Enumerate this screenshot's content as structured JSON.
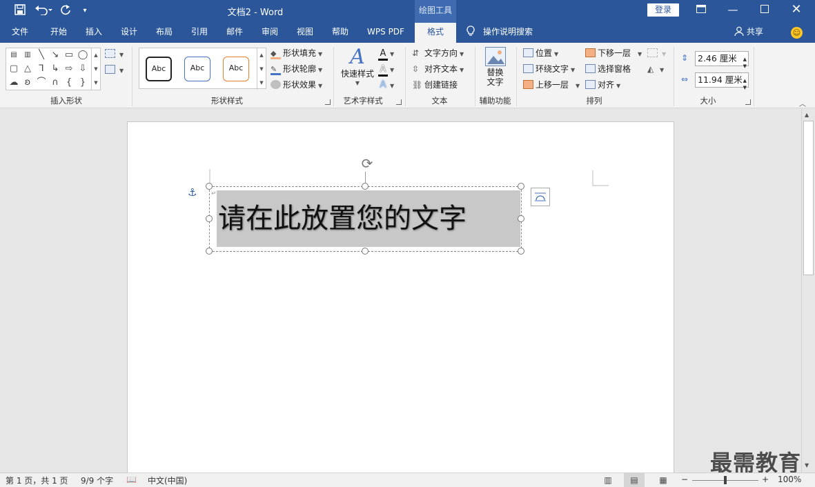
{
  "titlebar": {
    "doc_title": "文档2  -  Word",
    "context_tab_title": "绘图工具",
    "login_label": "登录",
    "icons": [
      "save-icon",
      "undo-icon",
      "redo-icon",
      "customize-quick-access-icon",
      "ribbon-display-options-icon",
      "minimize-icon",
      "maximize-icon",
      "close-icon"
    ]
  },
  "tabs": {
    "items": [
      "文件",
      "开始",
      "插入",
      "设计",
      "布局",
      "引用",
      "邮件",
      "审阅",
      "视图",
      "帮助",
      "WPS PDF",
      "格式"
    ],
    "active": "格式",
    "tell_me": "操作说明搜索",
    "share": "共享"
  },
  "ribbon": {
    "groups": {
      "insert_shapes": "插入形状",
      "shape_styles": "形状样式",
      "wordart_styles": "艺术字样式",
      "text": "文本",
      "accessibility": "辅助功能",
      "arrange": "排列",
      "size": "大小"
    },
    "shape_styles": {
      "previews": [
        "Abc",
        "Abc",
        "Abc"
      ],
      "preview_colors": [
        "#222222",
        "#4472c4",
        "#ed7d31"
      ],
      "fill": "形状填充",
      "outline": "形状轮廓",
      "effects": "形状效果"
    },
    "wordart": {
      "quick_styles": "快速样式"
    },
    "text": {
      "direction": "文字方向",
      "align": "对齐文本",
      "link": "创建链接"
    },
    "accessibility": {
      "alt_text_line1": "替换",
      "alt_text_line2": "文字"
    },
    "arrange": {
      "position": "位置",
      "wrap": "环绕文字",
      "bring_forward": "上移一层",
      "send_backward": "下移一层",
      "selection_pane": "选择窗格",
      "align": "对齐"
    },
    "size": {
      "height": "2.46 厘米",
      "width": "11.94 厘米"
    }
  },
  "document": {
    "textbox_text": "请在此放置您的文字"
  },
  "statusbar": {
    "page": "第 1 页，共 1 页",
    "words": "9/9 个字",
    "language": "中文(中国)",
    "zoom": "100%",
    "zoom_out": "−",
    "zoom_in": "+"
  },
  "watermark": "最需教育"
}
